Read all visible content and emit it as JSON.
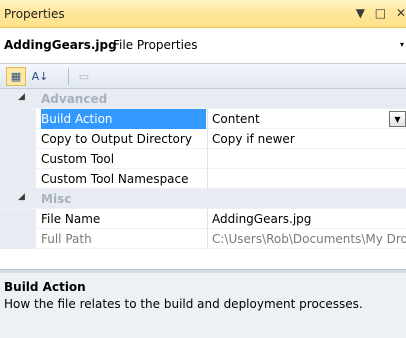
{
  "window": {
    "title": "Properties",
    "dropdown_glyph": "▼",
    "maximize_glyph": "□",
    "close_glyph": "✕"
  },
  "object_selector": {
    "name": "AddingGears.jpg",
    "type": "File Properties",
    "arrow_glyph": "▾"
  },
  "toolbar": {
    "categorized_icon": "categorized-icon",
    "alphabetical_icon": "alphabetical-icon",
    "property_pages_icon": "property-pages-icon",
    "categorized_glyph": "▦",
    "alphabetical_glyph": "A↓",
    "property_pages_glyph": "▭",
    "categorized_active": true
  },
  "grid": {
    "collapse_glyph": "◢",
    "combo_glyph": "▼",
    "categories": [
      {
        "label": "Advanced",
        "properties": [
          {
            "name": "Build Action",
            "value": "Content",
            "selected": true,
            "has_dropdown": true
          },
          {
            "name": "Copy to Output Directory",
            "value": "Copy if newer"
          },
          {
            "name": "Custom Tool",
            "value": ""
          },
          {
            "name": "Custom Tool Namespace",
            "value": ""
          }
        ]
      },
      {
        "label": "Misc",
        "properties": [
          {
            "name": "File Name",
            "value": "AddingGears.jpg"
          },
          {
            "name": "Full Path",
            "value": "C:\\Users\\Rob\\Documents\\My Dro",
            "readonly": true
          }
        ]
      }
    ]
  },
  "description": {
    "title": "Build Action",
    "text": "How the file relates to the build and deployment processes."
  },
  "colors": {
    "titlebar": "#ffe79b",
    "selection": "#3399ff",
    "category_background": "#e8ecf2",
    "description_background": "#edf0f5"
  }
}
